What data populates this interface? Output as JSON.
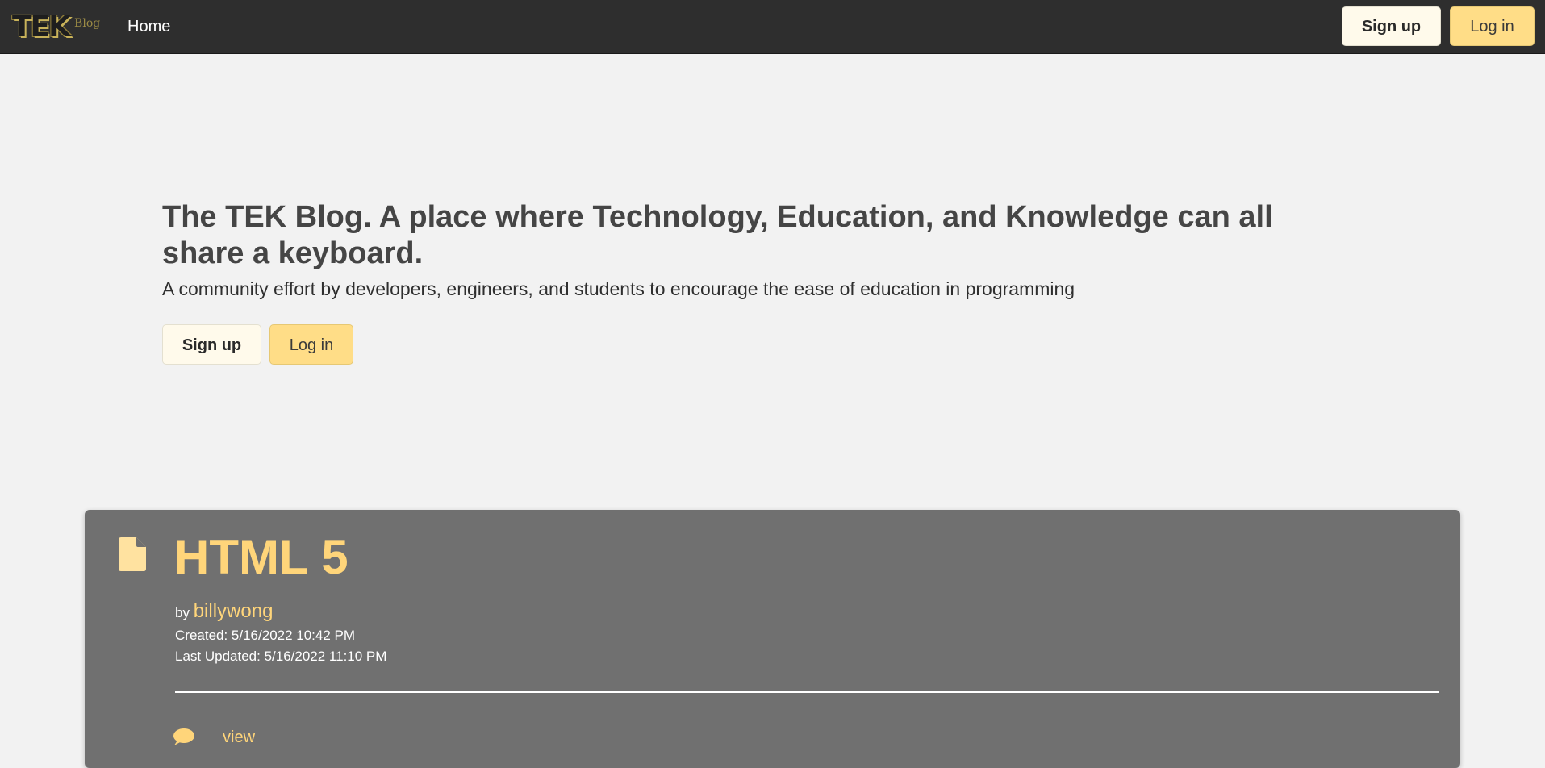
{
  "navbar": {
    "brand_main": "TEK",
    "brand_sub": "Blog",
    "home_label": "Home",
    "signup_label": "Sign up",
    "login_label": "Log in"
  },
  "hero": {
    "title": "The TEK Blog. A place where Technology, Education, and Knowledge can all share a keyboard.",
    "subtitle": "A community effort by developers, engineers, and students to encourage the ease of education in programming",
    "signup_label": "Sign up",
    "login_label": "Log in"
  },
  "post": {
    "icon": "file-icon",
    "title": "HTML 5",
    "by_label": "by",
    "author": "billywong",
    "created": "Created: 5/16/2022 10:42 PM",
    "updated": "Last Updated: 5/16/2022 11:10 PM",
    "comment_icon": "comment-icon",
    "view_label": "view"
  },
  "colors": {
    "navbar_bg": "#2e2e2e",
    "page_bg": "#f2f2f2",
    "accent": "#ffd57a",
    "signup_bg": "#fffaeb",
    "login_bg": "#ffdd87",
    "card_bg": "#707070"
  }
}
